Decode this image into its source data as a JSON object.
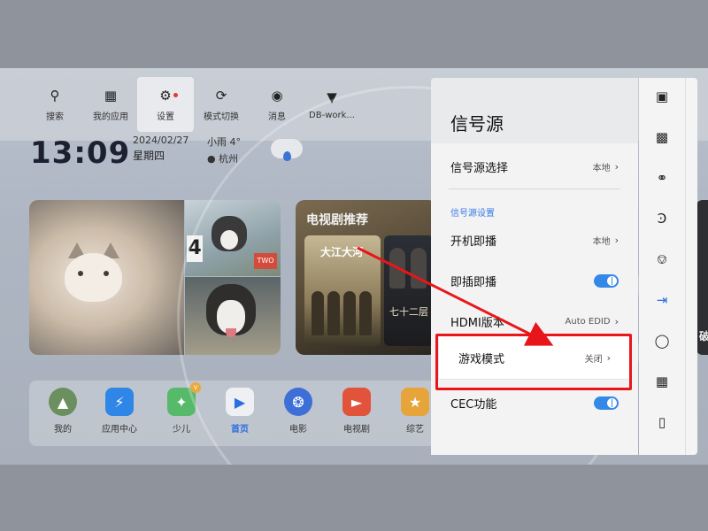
{
  "top_bar": {
    "items": [
      {
        "label": "搜索",
        "icon": "search-icon"
      },
      {
        "label": "我的应用",
        "icon": "apps-grid-icon"
      },
      {
        "label": "设置",
        "icon": "settings-gear-icon"
      },
      {
        "label": "模式切换",
        "icon": "mode-switch-icon"
      },
      {
        "label": "消息",
        "icon": "message-icon"
      },
      {
        "label": "DB-work...",
        "icon": "wifi-icon"
      }
    ]
  },
  "clock": {
    "time": "13:09",
    "date": "2024/02/27",
    "weekday": "星期四",
    "weather": "小雨 4°",
    "city": "杭州"
  },
  "cards": {
    "drama_title": "电视剧推荐",
    "poster1_title": "大江大河",
    "poster2_title": "七十二层",
    "dog_sign": "4",
    "dog_sign2": "TWO",
    "edge_char": "破"
  },
  "dock": {
    "items": [
      {
        "label": "我的",
        "icon": "avatar-icon",
        "color": "#6b8f5e"
      },
      {
        "label": "应用中心",
        "icon": "app-store-icon",
        "color": "#2f86e6"
      },
      {
        "label": "少儿",
        "icon": "kids-icon",
        "color": "#57b96a"
      },
      {
        "label": "首页",
        "icon": "home-play-icon",
        "color": "#2a6fe0"
      },
      {
        "label": "电影",
        "icon": "film-reel-icon",
        "color": "#3d6fd6"
      },
      {
        "label": "电视剧",
        "icon": "tv-series-icon",
        "color": "#e2533c"
      },
      {
        "label": "综艺",
        "icon": "variety-star-icon",
        "color": "#e6a43a"
      }
    ]
  },
  "panel": {
    "title": "信号源",
    "source_select": {
      "label": "信号源选择",
      "value": "本地"
    },
    "section": "信号源设置",
    "boot_play": {
      "label": "开机即播",
      "value": "本地"
    },
    "plug_play": {
      "label": "即插即播",
      "enabled": true
    },
    "hdmi": {
      "label": "HDMI版本",
      "value": "Auto EDID"
    },
    "game_mode": {
      "label": "游戏模式",
      "value": "关闭"
    },
    "cec": {
      "label": "CEC功能",
      "enabled": true
    },
    "chevron": "›"
  },
  "strip_icons": [
    "picture-mode-icon",
    "image-settings-icon",
    "planet-network-icon",
    "bluetooth-icon",
    "bell-notification-icon",
    "signal-source-icon",
    "eye-protect-icon",
    "app-grid-icon",
    "remote-icon"
  ],
  "colors": {
    "accent": "#2a6fe0",
    "highlight": "#e8161a",
    "toggle_on": "#3388e8"
  }
}
